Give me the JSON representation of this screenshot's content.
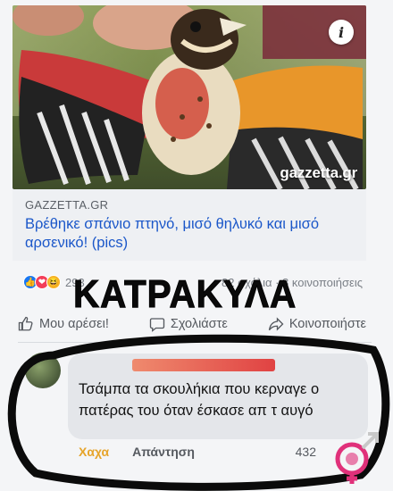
{
  "post": {
    "watermark": "gazzetta.gr",
    "info_icon": "i",
    "source": "GAZZETTA.GR",
    "headline": "Βρέθηκε σπάνιο πτηνό, μισό θηλυκό και μισό αρσενικό! (pics)"
  },
  "stats": {
    "reactions_count": "293",
    "comments_shares": "82 σχόλια · 8 κοινοποιήσεις",
    "reaction_icons": [
      "like-icon",
      "love-icon",
      "haha-icon"
    ]
  },
  "overlay": {
    "stamp_text": "ΚΑΤΡΑΚΥΛΑ"
  },
  "actions": {
    "like": "Μου αρέσει!",
    "comment": "Σχολιάστε",
    "share": "Κοινοποιήστε"
  },
  "comment": {
    "text": "Τσάμπα τα σκουλήκια που κερναγε ο πατέρας του όταν έσκασε απ τ αυγό",
    "reaction_label": "Χαχα",
    "reply_label": "Απάντηση",
    "count": "432"
  },
  "colors": {
    "link_blue": "#1b57c9",
    "haha_orange": "#e6a42a",
    "logo_pink": "#e0307a"
  }
}
